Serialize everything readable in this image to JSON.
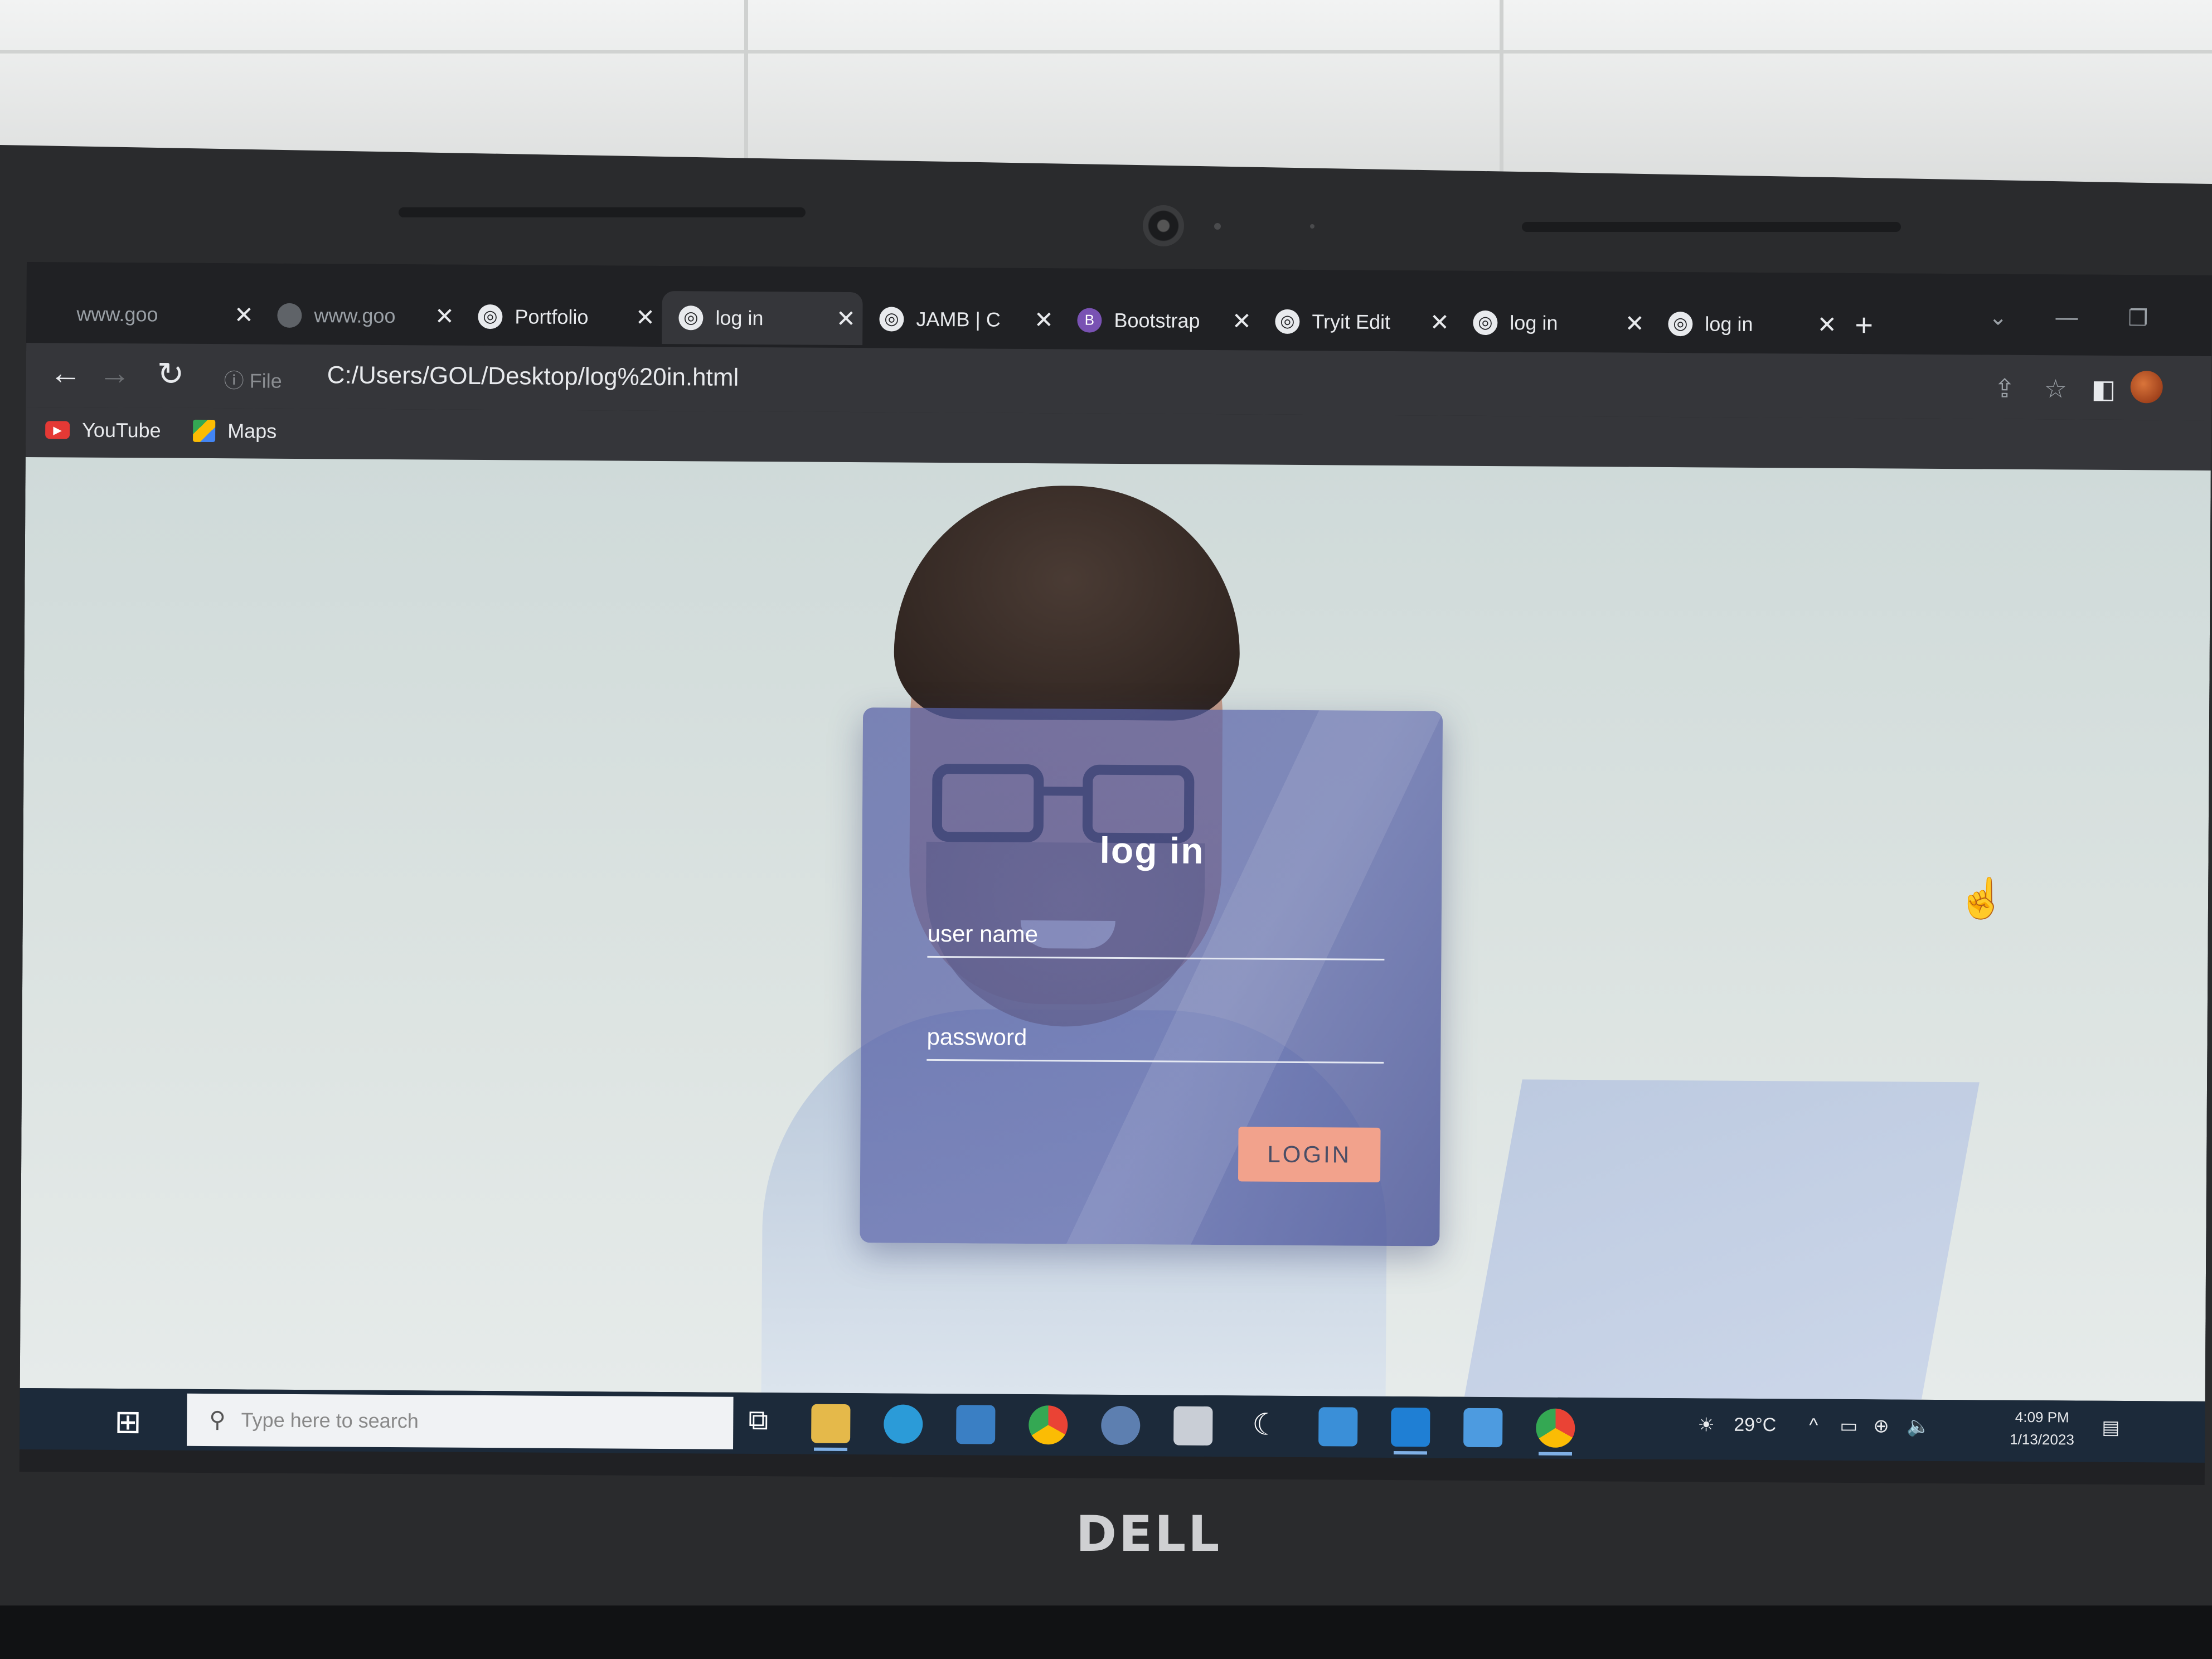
{
  "browser": {
    "tabs": [
      {
        "label": "www.goo",
        "icon": "loading-icon"
      },
      {
        "label": "www.goo",
        "icon": "loading-icon"
      },
      {
        "label": "Portfolio",
        "icon": "globe-icon"
      },
      {
        "label": "log in",
        "icon": "globe-icon"
      },
      {
        "label": "JAMB | C",
        "icon": "globe-icon"
      },
      {
        "label": "Bootstrap",
        "icon": "bootstrap-icon"
      },
      {
        "label": "Tryit Edit",
        "icon": "globe-icon"
      },
      {
        "label": "log in",
        "icon": "globe-icon"
      },
      {
        "label": "log in",
        "icon": "globe-icon"
      }
    ],
    "tab_close": "✕",
    "new_tab": "+",
    "address": {
      "file_label": "File",
      "url": "C:/Users/GOL/Desktop/log%20in.html"
    },
    "bookmarks": [
      {
        "label": "YouTube",
        "icon": "youtube-icon"
      },
      {
        "label": "Maps",
        "icon": "maps-icon"
      }
    ]
  },
  "page": {
    "login": {
      "title": "log in",
      "username_placeholder": "user name",
      "password_placeholder": "password",
      "button_label": "LOGIN",
      "button_color": "#f2a28c"
    }
  },
  "taskbar": {
    "search_placeholder": "Type here to search",
    "weather": "29°C",
    "time": "4:09 PM",
    "date": "1/13/2023"
  },
  "device": {
    "brand": "DELL"
  }
}
